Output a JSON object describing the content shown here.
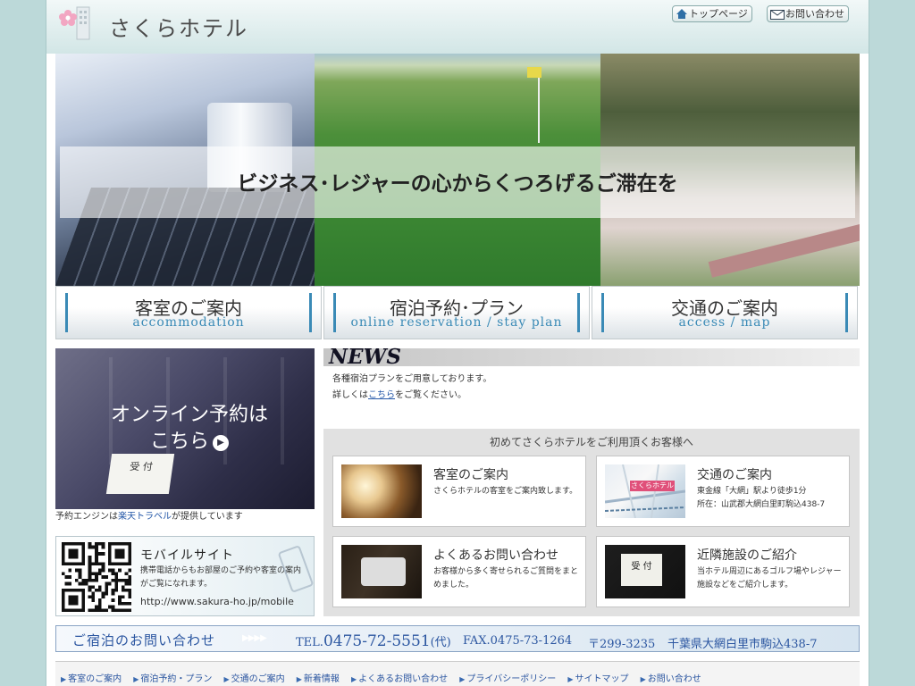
{
  "header": {
    "logo_text": "さくらホテル",
    "top_page": "トップページ",
    "contact": "お問い合わせ"
  },
  "hero": {
    "tagline": "ビジネス･レジャーの心からくつろげるご滞在を"
  },
  "nav": [
    {
      "jp": "客室のご案内",
      "en": "accommodation"
    },
    {
      "jp": "宿泊予約･プラン",
      "en": "online reservation / stay plan"
    },
    {
      "jp": "交通のご案内",
      "en": "access / map"
    }
  ],
  "online": {
    "line1": "オンライン予約は",
    "line2": "こちら",
    "arrow": "▶",
    "sign": "受 付",
    "note_prefix": "予約エンジンは",
    "note_link": "楽天トラベル",
    "note_suffix": "が提供しています"
  },
  "mobile": {
    "title": "モバイルサイト",
    "desc": "携帯電話からもお部屋のご予約や客室の案内がご覧になれます。",
    "url": "http://www.sakura-ho.jp/mobile"
  },
  "news": {
    "title": "NEWS",
    "line1": "各種宿泊プランをご用意しております。",
    "line2_prefix": "詳しくは",
    "line2_link": "こちら",
    "line2_suffix": "をご覧ください。"
  },
  "first": {
    "title": "初めてさくらホテルをご利用頂くお客様へ",
    "cards": [
      {
        "title": "客室のご案内",
        "desc": "さくらホテルの客室をご案内致します。"
      },
      {
        "title": "交通のご案内",
        "desc": "東金線「大網」駅より徒歩1分\n所在：山武郡大網白里町駒込438-7",
        "map_label": "さくらホテル"
      },
      {
        "title": "よくあるお問い合わせ",
        "desc": "お客様から多く寄せられるご質問をまとめました。"
      },
      {
        "title": "近隣施設のご紹介",
        "desc": "当ホテル周辺にあるゴルフ場やレジャー施設などをご紹介します。",
        "sign": "受 付"
      }
    ]
  },
  "inquiry": {
    "label": "ご宿泊のお問い合わせ",
    "arrows": "▶▶▶▶",
    "tel_prefix": "TEL.",
    "tel": "0475-72-5551",
    "tel_suffix": "(代)",
    "fax": "FAX.0475-73-1264",
    "zip": "〒299-3235",
    "address": "千葉県大網白里市駒込438-7"
  },
  "footer": {
    "links": [
      "客室のご案内",
      "宿泊予約・プラン",
      "交通のご案内",
      "新着情報",
      "よくあるお問い合わせ",
      "プライバシーポリシー",
      "サイトマップ",
      "お問い合わせ"
    ]
  },
  "colors": {
    "accent": "#3a8ab6",
    "inquiry_text": "#2a55a0",
    "background": "#bcd9d9"
  }
}
